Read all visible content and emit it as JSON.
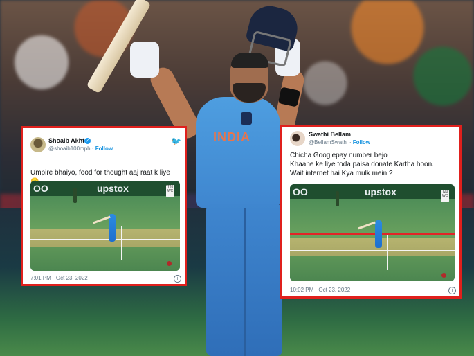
{
  "tweets": [
    {
      "name": "Shoaib Akhtar",
      "handle": "@shoaib100mph",
      "follow": "Follow",
      "text_line1": "Umpire bhaiyo, food for thought aaj raat k liye",
      "emoji": "😌",
      "media_hoarding": "upstox",
      "timestamp": "7:01 PM · Oct 23, 2022",
      "info_icon": "i"
    },
    {
      "name": "Swathi Bellam",
      "handle": "@BellamSwathi",
      "follow": "Follow",
      "text": "Chicha Googlepay number bejo\nKhaane ke liye toda paisa donate Kartha  hoon.\nWait internet hai Kya mulk mein ?",
      "media_hoarding": "upstox",
      "timestamp": "10:02 PM · Oct 23, 2022",
      "info_icon": "i"
    }
  ],
  "jersey_text": "INDIA",
  "colors": {
    "card_border": "#e0201d",
    "twitter_blue": "#1da1f2",
    "jersey_blue": "#4e9ee0"
  }
}
